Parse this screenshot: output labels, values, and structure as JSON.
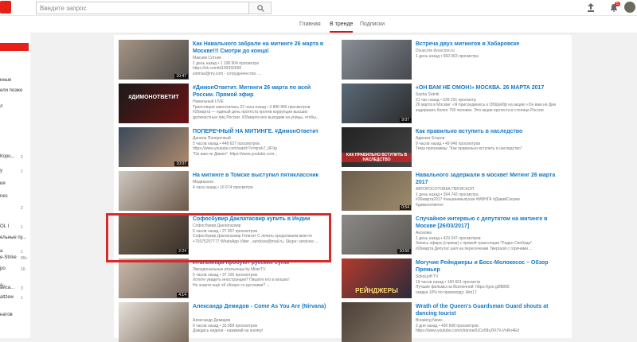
{
  "search": {
    "placeholder": "Введите запрос"
  },
  "header": {
    "notifications_count": "5"
  },
  "sidebar": {
    "items": [
      {
        "label": "нные",
        "count": ""
      },
      {
        "label": "ели позже",
        "count": ""
      },
      {
        "label": "л",
        "count": ""
      },
      {
        "label": "Коро...",
        "count": "2"
      },
      {
        "label": "y",
        "count": "1"
      },
      {
        "label": "ия",
        "count": ""
      },
      {
        "label": "nes",
        "count": ""
      },
      {
        "label": "",
        "count": "2"
      },
      {
        "label": "OL I",
        "count": "1"
      },
      {
        "label": "ельные пу...",
        "count": ""
      },
      {
        "label": "а",
        "count": "1"
      },
      {
        "label": "e-Strike",
        "count": "99+"
      },
      {
        "label": "ро",
        "count": "10"
      },
      {
        "label": "а",
        "count": ""
      },
      {
        "label": "айса...",
        "count": "3"
      },
      {
        "label": "altzew",
        "count": "1"
      },
      {
        "label": "натов",
        "count": ""
      }
    ]
  },
  "tabs": {
    "home": "Главная",
    "trending": "В тренде",
    "subscriptions": "Подписки"
  },
  "videos": [
    {
      "title": "Как Навального забрали на митинге 26 марта в Москве!!! Смотри до конца!",
      "channel": "Максим Сотник",
      "stats": "1 день назад • 1 108 904 просмотра",
      "desc1": "https://vk.com/id199392656",
      "desc2": "sotmax@my.com - сотрудничество. ...",
      "duration": "10:47",
      "overlay": ""
    },
    {
      "title": "Встреча двух митингов в Хабаровске",
      "channel": "Dvuscore dvuscore.ru",
      "stats": "1 день назад • 560 063 просмотра",
      "desc1": "",
      "desc2": "",
      "duration": "",
      "overlay": ""
    },
    {
      "title": "#ДимонОтветит. Митинги 26 марта по всей России. Прямой эфир",
      "channel": "Навальный LIVE",
      "stats": "Трансляция закончилась 22 часа назад • 3 896 866 просмотров",
      "desc1": "#26марта — единый день протеста против коррупции высших",
      "desc2": "должностных лиц России. #26марта все выходим на улицы, чтобы...",
      "duration": "",
      "overlay": "#ДИМОНОТВЕТИТ"
    },
    {
      "title": "«ОН ВАМ НЕ ОМОН!» МОСКВА. 26 МАРТА 2017",
      "channel": "Sasha Sotnik",
      "stats": "21 час назад • 539 201 просмотр",
      "desc1": "26 марта в Москве: «Я присоединюсь к ОБЩеИф на акцию «Он вам не Димон» в Москве",
      "desc2": "задержано более 700 человек. Эти акции протеста в столице России",
      "duration": "9:07",
      "overlay": ""
    },
    {
      "title": "ПОПЕРЕЧНЫЙ НА МИТИНГЕ. #ДимонОтветит",
      "channel": "Данила Поперечный",
      "stats": "5 часов назад • 448 627 просмотров",
      "desc1": "https://www.youtube.com/watch?v=qnvk7_0F9g",
      "desc2": "\"Он вам не Димон\". https://www.youtube.com...",
      "duration": "10:07",
      "overlay": ""
    },
    {
      "title": "Как правильно вступить в наследство",
      "channel": "Адвокат Егоров",
      "stats": "9 часов назад • 49 646 просмотров",
      "desc1": "Тема программы: \"Как правильно вступить в наследство\"",
      "desc2": "",
      "duration": "",
      "overlay": "КАК ПРАВИЛЬНО ВСТУПИТЬ В НАСЛЕДСТВО"
    },
    {
      "title": "На митинге в Томске выступил пятиклассник",
      "channel": "Медиазона",
      "stats": "4 часа назад • 16 674 просмотра",
      "desc1": "",
      "desc2": "",
      "duration": "",
      "overlay": ""
    },
    {
      "title": "Навального задержали в москве! Митинг 26 марта 2017",
      "channel": "АВТОРОСОТОВКА ПЕРИСКОП",
      "stats": "1 день назад • 394 742 просмотра",
      "desc1": "#26марта2017 #нашиневыпуски #МИНГА #ДавайСкорее",
      "desc2": "#димонответит",
      "duration": "0:54",
      "overlay": ""
    },
    {
      "title": "Софосбувир Даклатасвир купить в Индии",
      "channel": "Софосбувир Даклатасвир",
      "stats": "6 часов назад • 27 907 просмотров",
      "desc1": "Софосбувир Даклатасвир Гепатит С лечить продолжаем вместе",
      "desc2": "+79375257777 WhatsApp Viber , serdcew@mail.ru, Skype: serdcew ...",
      "duration": "2:24",
      "overlay": ""
    },
    {
      "title": "Случайное интервью с депутатом на митинге в Москве [26/03/2017]",
      "channel": "Аксиома",
      "stats": "1 день назад • 429 247 просмотров",
      "desc1": "Запись эфира (стрима) с прямой трансляции \"Радио Свобода\".",
      "desc2": "#26марта Депутат шел на пересечении Тверской с горячими ...",
      "duration": "10:50",
      "overlay": ""
    },
    {
      "title": "Итальянцы пробуют русские супы",
      "channel": "Эмоциональные итальянцы by MilanTV",
      "stats": "5 часов назад • 37 105 просмотров",
      "desc1": "Хотите увидеть иностранцев? Пишите его в окошко!",
      "desc2": "Не знаете ещё об обзоре со русскими? ...",
      "duration": "4:14",
      "overlay": ""
    },
    {
      "title": "Могучие Рейнджеры и Босс-Молокосос – Обзор Премьер",
      "channel": "SokoLjoff TV",
      "stats": "19 часов назад • 160 661 просмотр",
      "desc1": "Лучшие фильмы на Вселенной: https://goo.gl/f8895",
      "desc2": "скидка 10% по промокоду: Aim17",
      "duration": "",
      "overlay": "РЕЙНДЖЕРЫ"
    },
    {
      "title": "Александр Демидов - Come As You Are (Nirvana)",
      "channel": "Александр Демидов",
      "stats": "6 часов назад • 33 958 просмотров",
      "desc1": "Дождись недели - нажимай на кнопку!",
      "desc2": "",
      "duration": "",
      "overlay": ""
    },
    {
      "title": "Wrath of the Queen's Guardsman Guard shouts at dancing tourist",
      "channel": "Breaking News",
      "stats": "2 дня назад • 430 608 просмотров",
      "desc1": "https://www.youtube.com/channel/UCe58sZFt79-VnRn4Ed",
      "desc2": "",
      "duration": "",
      "overlay": ""
    }
  ],
  "colors": {
    "accent": "#e62117",
    "link": "#167ac6",
    "highlight": "#d62b2b"
  }
}
